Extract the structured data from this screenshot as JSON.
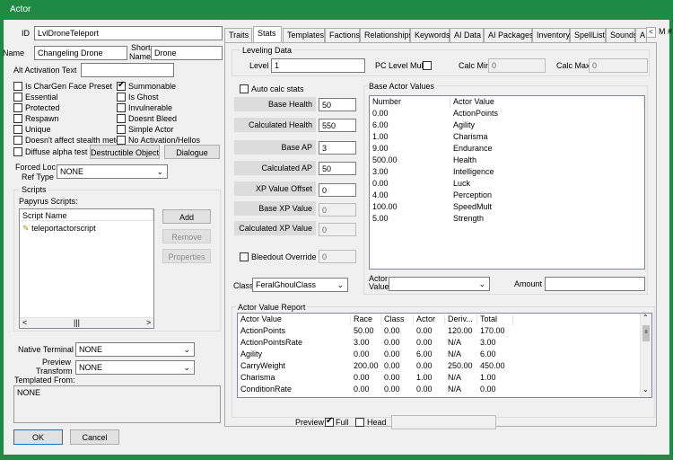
{
  "window": {
    "title": "Actor"
  },
  "left": {
    "id_label": "ID",
    "id_value": "LvlDroneTeleport",
    "name_label": "Name",
    "name_value": "Changeling Drone",
    "short_name_label1": "Short",
    "short_name_label2": "Name",
    "short_name_value": "Drone",
    "alt_activation_label": "Alt Activation Text",
    "alt_activation_value": "",
    "checkboxes_left": [
      {
        "label": "Is CharGen Face Preset",
        "checked": false
      },
      {
        "label": "Essential",
        "checked": false
      },
      {
        "label": "Protected",
        "checked": false
      },
      {
        "label": "Respawn",
        "checked": false
      },
      {
        "label": "Unique",
        "checked": false
      },
      {
        "label": "Doesn't affect stealth meter",
        "checked": false
      },
      {
        "label": "Diffuse alpha test",
        "checked": false
      }
    ],
    "checkboxes_right": [
      {
        "label": "Summonable",
        "checked": true
      },
      {
        "label": "Is Ghost",
        "checked": false
      },
      {
        "label": "Invulnerable",
        "checked": false
      },
      {
        "label": "Doesnt Bleed",
        "checked": false
      },
      {
        "label": "Simple Actor",
        "checked": false
      },
      {
        "label": "No Activation/Hellos",
        "checked": false
      }
    ],
    "destructible_button": "Destructible Object",
    "dialogue_button": "Dialogue",
    "forced_loc_label1": "Forced Loc",
    "forced_loc_label2": "Ref Type",
    "forced_loc_value": "NONE",
    "scripts_label": "Scripts",
    "papyrus_label": "Papyrus Scripts:",
    "script_name_header": "Script Name",
    "scripts": [
      "teleportactorscript"
    ],
    "add_button": "Add",
    "remove_button": "Remove",
    "properties_button": "Properties",
    "native_terminal_label": "Native Terminal",
    "native_terminal_value": "NONE",
    "preview_transform_label1": "Preview",
    "preview_transform_label2": "Transform",
    "preview_transform_value": "NONE",
    "templated_from_label": "Templated From:",
    "templated_from_value": "NONE",
    "ok_button": "OK",
    "cancel_button": "Cancel"
  },
  "tabs": [
    "Traits",
    "Stats",
    "Templates",
    "Factions",
    "Relationships",
    "Keywords",
    "AI Data",
    "AI Packages",
    "Inventory",
    "SpellList",
    "Sounds",
    "A"
  ],
  "tabs_overflow_label": "M #",
  "stats": {
    "leveling_title": "Leveling Data",
    "level_label": "Level",
    "level_value": "1",
    "pc_level_mult_label": "PC Level Mult",
    "calc_min_label": "Calc Min",
    "calc_min_value": "0",
    "calc_max_label": "Calc Max",
    "calc_max_value": "0",
    "auto_calc_label": "Auto calc stats",
    "fields": [
      {
        "label": "Base Health",
        "value": "50",
        "disabled": false
      },
      {
        "label": "Calculated Health",
        "value": "550",
        "disabled": false
      },
      {
        "label": "Base AP",
        "value": "3",
        "disabled": false
      },
      {
        "label": "Calculated AP",
        "value": "50",
        "disabled": false
      },
      {
        "label": "XP Value Offset",
        "value": "0",
        "disabled": false
      },
      {
        "label": "Base XP Value",
        "value": "0",
        "disabled": true
      },
      {
        "label": "Calculated XP Value",
        "value": "0",
        "disabled": true
      }
    ],
    "bleedout_label": "Bleedout Override",
    "bleedout_value": "0",
    "class_label": "Class",
    "class_value": "FeralGhoulClass",
    "base_av_title": "Base Actor Values",
    "base_av_headers": [
      "Number",
      "Actor Value"
    ],
    "base_av_rows": [
      [
        "0.00",
        "ActionPoints"
      ],
      [
        "6.00",
        "Agility"
      ],
      [
        "1.00",
        "Charisma"
      ],
      [
        "9.00",
        "Endurance"
      ],
      [
        "500.00",
        "Health"
      ],
      [
        "3.00",
        "Intelligence"
      ],
      [
        "0.00",
        "Luck"
      ],
      [
        "4.00",
        "Perception"
      ],
      [
        "100.00",
        "SpeedMult"
      ],
      [
        "5.00",
        "Strength"
      ]
    ],
    "actor_value_label1": "Actor",
    "actor_value_label2": "Value",
    "actor_value_value": "",
    "amount_label": "Amount",
    "amount_value": "",
    "report_title": "Actor Value Report",
    "report_headers": [
      "Actor Value",
      "Race",
      "Class",
      "Actor",
      "Deriv...",
      "Total"
    ],
    "report_rows": [
      [
        "ActionPoints",
        "50.00",
        "0.00",
        "0.00",
        "120.00",
        "170.00"
      ],
      [
        "ActionPointsRate",
        "3.00",
        "0.00",
        "0.00",
        "N/A",
        "3.00"
      ],
      [
        "Agility",
        "0.00",
        "0.00",
        "6.00",
        "N/A",
        "6.00"
      ],
      [
        "CarryWeight",
        "200.00",
        "0.00",
        "0.00",
        "250.00",
        "450.00"
      ],
      [
        "Charisma",
        "0.00",
        "0.00",
        "1.00",
        "N/A",
        "1.00"
      ],
      [
        "ConditionRate",
        "0.00",
        "0.00",
        "0.00",
        "N/A",
        "0.00"
      ]
    ]
  },
  "preview": {
    "label": "Preview",
    "full_label": "Full",
    "full_checked": true,
    "head_label": "Head",
    "head_checked": false
  }
}
